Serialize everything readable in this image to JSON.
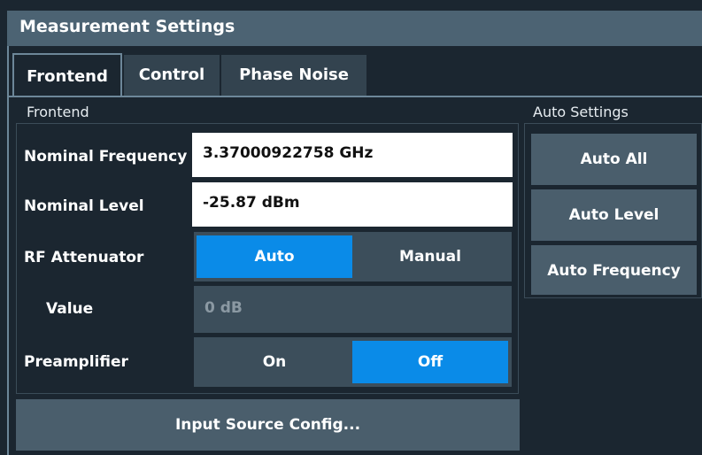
{
  "window": {
    "title": "Measurement Settings"
  },
  "tabs": [
    {
      "label": "Frontend",
      "active": true
    },
    {
      "label": "Control",
      "active": false
    },
    {
      "label": "Phase Noise",
      "active": false
    }
  ],
  "frontend": {
    "group_label": "Frontend",
    "nominal_frequency": {
      "label": "Nominal Frequency",
      "value": "3.37000922758 GHz"
    },
    "nominal_level": {
      "label": "Nominal Level",
      "value": "-25.87 dBm"
    },
    "rf_attenuator": {
      "label": "RF Attenuator",
      "options": [
        "Auto",
        "Manual"
      ],
      "selected": "Auto"
    },
    "value": {
      "label": "Value",
      "value": "0 dB",
      "enabled": false
    },
    "preamplifier": {
      "label": "Preamplifier",
      "options": [
        "On",
        "Off"
      ],
      "selected": "Off"
    },
    "input_source_button": "Input Source Config..."
  },
  "auto_settings": {
    "group_label": "Auto Settings",
    "buttons": [
      "Auto All",
      "Auto Level",
      "Auto Frequency"
    ]
  },
  "colors": {
    "background": "#1b2630",
    "titlebar": "#4c6373",
    "selected": "#0a8be8",
    "unselected": "#3c4e5b",
    "button": "#4a5e6c",
    "input": "#ffffff"
  }
}
